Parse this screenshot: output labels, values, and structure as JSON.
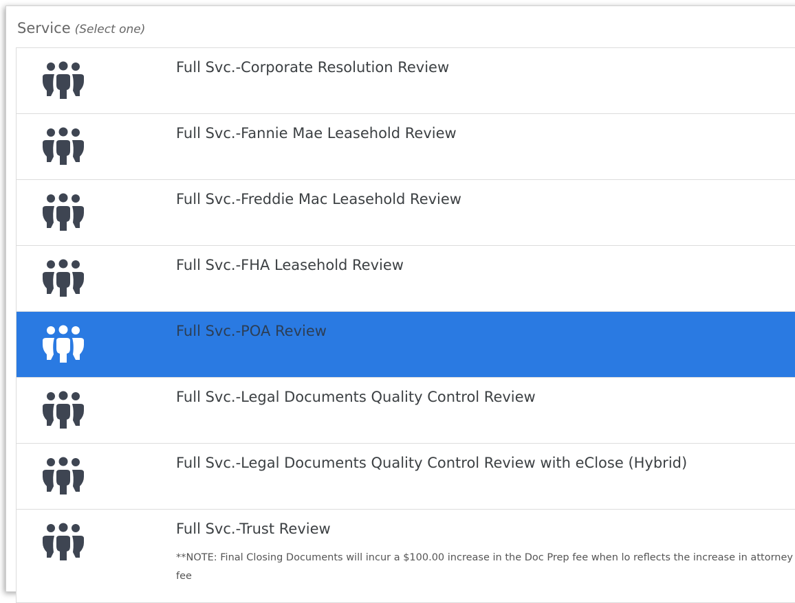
{
  "header": {
    "label": "Service",
    "hint": "(Select one)"
  },
  "colors": {
    "selected_row": "#2a7ae2",
    "icon": "#3e4552",
    "icon_selected": "#ffffff"
  },
  "services": [
    {
      "title": "Full Svc.-Corporate Resolution Review",
      "icon": "group-icon"
    },
    {
      "title": "Full Svc.-Fannie Mae Leasehold Review",
      "icon": "group-icon"
    },
    {
      "title": "Full Svc.-Freddie Mac Leasehold Review",
      "icon": "group-icon"
    },
    {
      "title": "Full Svc.-FHA Leasehold Review",
      "icon": "group-icon"
    },
    {
      "title": "Full Svc.-POA Review",
      "icon": "group-icon",
      "selected": true
    },
    {
      "title": "Full Svc.-Legal Documents Quality Control Review",
      "icon": "group-icon"
    },
    {
      "title": "Full Svc.-Legal Documents Quality Control Review with eClose (Hybrid)",
      "icon": "group-icon"
    },
    {
      "title": "Full Svc.-Trust Review",
      "icon": "group-icon",
      "note": "**NOTE: Final Closing Documents will incur a $100.00 increase in the Doc Prep fee when lo reflects the increase in attorney fee"
    }
  ]
}
